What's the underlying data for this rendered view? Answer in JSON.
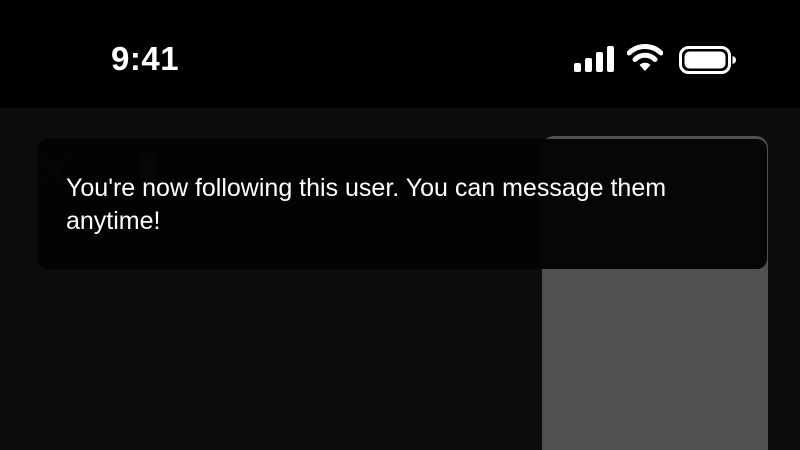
{
  "status_bar": {
    "time": "9:41",
    "icons": [
      "signal-icon",
      "wifi-icon",
      "battery-icon"
    ]
  },
  "background": {
    "icons": [
      "close-icon",
      "profile-icon"
    ]
  },
  "toast": {
    "message": "You're now following this user. You can message them anytime!"
  },
  "colors": {
    "background": "#000000",
    "content_dim": "#0c0c0d",
    "toast_bg": "#030304",
    "media_card": "#505050",
    "text": "#ffffff"
  }
}
